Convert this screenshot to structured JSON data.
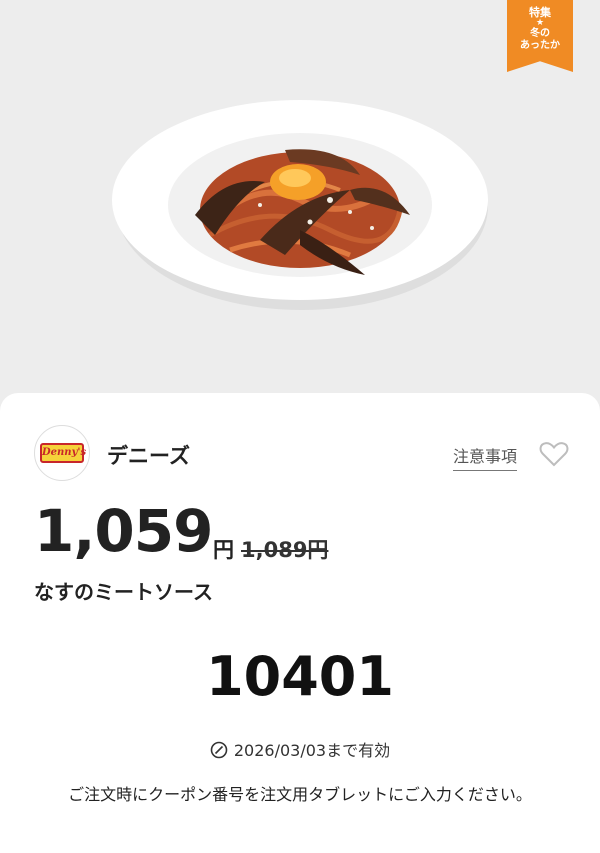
{
  "ribbon": {
    "title": "特集",
    "star": "★",
    "line1": "冬の",
    "line2": "あったか",
    "color": "#f08b24"
  },
  "shop": {
    "logo_text": "Denny's",
    "name": "デニーズ"
  },
  "notes_link": "注意事項",
  "price": {
    "current": "1,059",
    "unit": "円",
    "original": "1,089円"
  },
  "item_name": "なすのミートソース",
  "coupon_code": "10401",
  "expiry": "2026/03/03まで有効",
  "instruction": "ご注文時にクーポン番号を注文用タブレットにご入力ください。",
  "icons": [
    "heart-icon",
    "clock-icon"
  ]
}
